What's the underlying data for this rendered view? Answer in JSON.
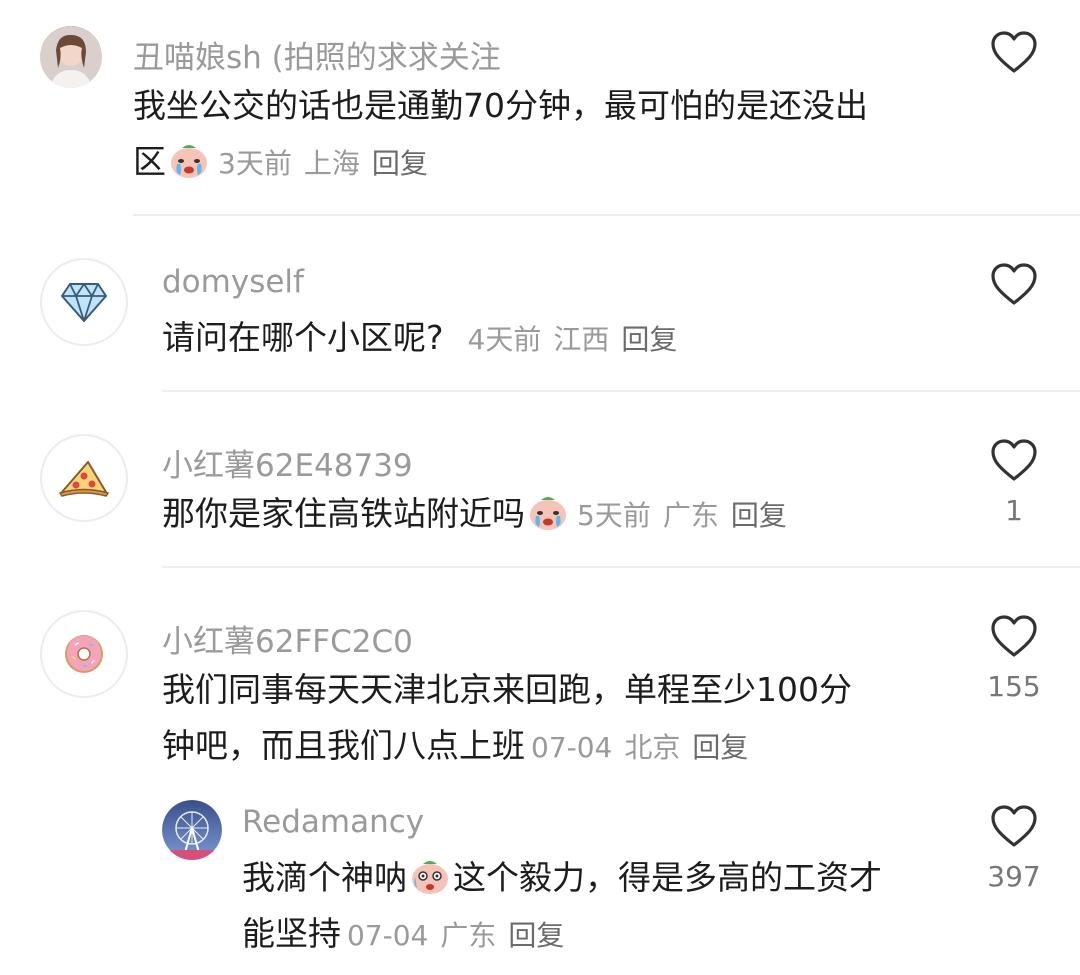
{
  "comments": [
    {
      "username": "丑喵娘sh (拍照的求求关注",
      "text_line1": "我坐公交的话也是通勤70分钟，最可怕的是还没出",
      "text_line2": "区",
      "emoji": "crying-face",
      "time": "3天前",
      "location": "上海",
      "reply": "回复",
      "likes": ""
    },
    {
      "username": "domyself",
      "avatar_icon": "diamond-icon",
      "text_line1": "请问在哪个小区呢?",
      "time": "4天前",
      "location": "江西",
      "reply": "回复",
      "likes": ""
    },
    {
      "username": "小红薯62E48739",
      "avatar_icon": "pizza-icon",
      "text_line1": "那你是家住高铁站附近吗",
      "emoji": "crying-face",
      "time": "5天前",
      "location": "广东",
      "reply": "回复",
      "likes": "1"
    },
    {
      "username": "小红薯62FFC2C0",
      "avatar_icon": "donut-icon",
      "text_line1": "我们同事每天天津北京来回跑，单程至少100分",
      "text_line2": "钟吧，而且我们八点上班",
      "time": "07-04",
      "location": "北京",
      "reply": "回复",
      "likes": "155"
    },
    {
      "username": "Redamancy",
      "avatar_icon": "ferris-wheel-icon",
      "text_line1_a": "我滴个神呐",
      "emoji": "shocked-face",
      "text_line1_b": "这个毅力，得是多高的工资才",
      "text_line2": "能坚持",
      "time": "07-04",
      "location": "广东",
      "reply": "回复",
      "likes": "397"
    }
  ]
}
